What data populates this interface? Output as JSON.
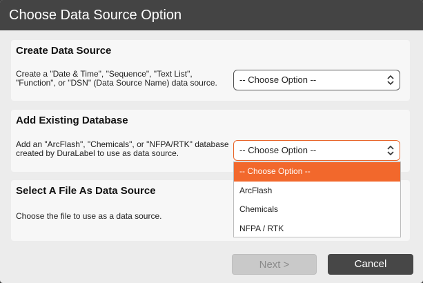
{
  "window": {
    "title": "Choose Data Source Option"
  },
  "create": {
    "heading": "Create Data Source",
    "desc_line1": "Create a \"Date & Time\", \"Sequence\", \"Text List\",",
    "desc_line2": "\"Function\",  or \"DSN\" (Data Source Name) data source.",
    "select_value": "-- Choose Option --"
  },
  "existing": {
    "heading": "Add Existing Database",
    "desc_line1": "Add an \"ArcFlash\", \"Chemicals\", or \"NFPA/RTK\" database",
    "desc_line2": "created by DuraLabel to use as data source.",
    "select_value": "-- Choose Option --",
    "options": [
      "-- Choose Option --",
      "ArcFlash",
      "Chemicals",
      "NFPA / RTK"
    ]
  },
  "file": {
    "heading": "Select A File As Data Source",
    "desc": "Choose the file to use as a data source."
  },
  "buttons": {
    "next": "Next >",
    "cancel": "Cancel"
  },
  "colors": {
    "accent": "#f2682c",
    "titlebar": "#444444",
    "cancel_bg": "#474747"
  }
}
